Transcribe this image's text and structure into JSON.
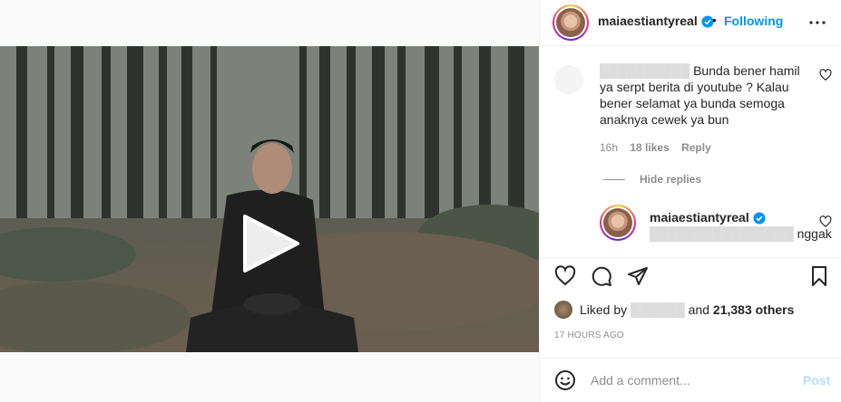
{
  "post": {
    "username": "maiaestiantyreal",
    "separator": "•",
    "follow_label": "Following",
    "more_icon": "more-horizontal-icon"
  },
  "comment": {
    "text_line1": "Bunda bener hamil",
    "text_rest": "ya serpt berita di youtube ? Kalau bener selamat ya bunda semoga anaknya cewek ya bun",
    "time": "16h",
    "likes": "18 likes",
    "reply_label": "Reply",
    "hide_replies_label": "Hide replies"
  },
  "reply": {
    "username": "maiaestiantyreal",
    "text": "nggak"
  },
  "likes": {
    "prefix": "Liked by",
    "suffix": "and",
    "count": "21,383 others"
  },
  "timestamp": "17 HOURS AGO",
  "add_comment": {
    "placeholder": "Add a comment...",
    "post_label": "Post"
  },
  "colors": {
    "accent": "#0095f6",
    "post_disabled": "#b2dffc",
    "muted": "#8e8e8e"
  }
}
